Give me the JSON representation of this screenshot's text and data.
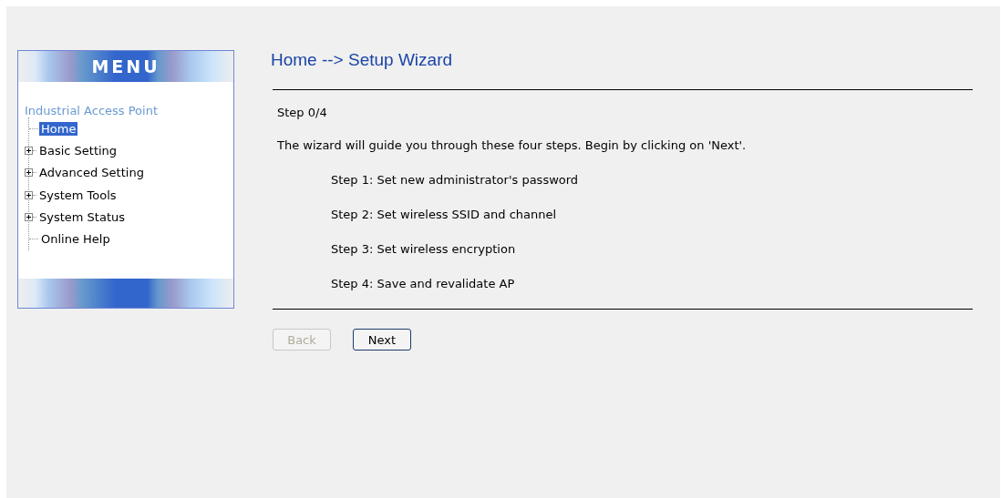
{
  "menu": {
    "title": "MENU",
    "root": "Industrial Access Point",
    "items": [
      {
        "label": "Home",
        "kind": "page",
        "selected": true
      },
      {
        "label": "Basic Setting",
        "kind": "folder",
        "selected": false
      },
      {
        "label": "Advanced Setting",
        "kind": "folder",
        "selected": false
      },
      {
        "label": "System Tools",
        "kind": "folder",
        "selected": false
      },
      {
        "label": "System Status",
        "kind": "folder",
        "selected": false
      },
      {
        "label": "Online Help",
        "kind": "page",
        "selected": false
      }
    ]
  },
  "breadcrumb": "Home --> Setup Wizard",
  "step": "Step 0/4",
  "intro": "The wizard will guide you through these four steps. Begin by clicking on 'Next'.",
  "steps": [
    "Step 1: Set new administrator's password",
    "Step 2: Set wireless SSID and channel",
    "Step 3: Set wireless encryption",
    "Step 4: Save and revalidate AP"
  ],
  "buttons": [
    {
      "label": "Back",
      "disabled": true
    },
    {
      "label": "Next",
      "disabled": false
    }
  ]
}
